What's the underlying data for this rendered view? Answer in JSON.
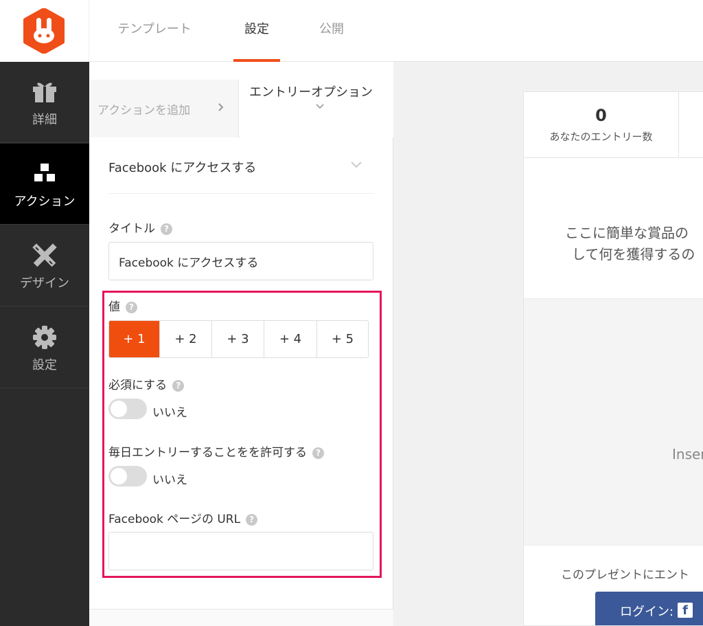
{
  "header": {
    "tabs": [
      {
        "label": "テンプレート"
      },
      {
        "label": "設定"
      },
      {
        "label": "公開"
      }
    ]
  },
  "sidebar": {
    "items": [
      {
        "label": "詳細",
        "icon": "gift-icon"
      },
      {
        "label": "アクション",
        "icon": "cubes-icon"
      },
      {
        "label": "デザイン",
        "icon": "pencil-ruler-icon"
      },
      {
        "label": "設定",
        "icon": "gear-icon"
      }
    ]
  },
  "panel": {
    "tab_add": "アクションを追加",
    "tab_entry": "エントリーオプション",
    "section_title": "Facebook にアクセスする",
    "title_label": "タイトル",
    "title_value": "Facebook にアクセスする",
    "value_label": "値",
    "value_options": [
      "+ 1",
      "+ 2",
      "+ 3",
      "+ 4",
      "+ 5"
    ],
    "value_selected": "+ 1",
    "required_label": "必須にする",
    "required_state": "いいえ",
    "daily_label": "毎日エントリーすることをを許可する",
    "daily_state": "いいえ",
    "fb_url_label": "Facebook ページの URL",
    "fb_url_value": ""
  },
  "preview": {
    "entries_count": "0",
    "entries_label": "あなたのエントリー数",
    "desc_line1": "ここに簡単な賞品の",
    "desc_line2": "して何を獲得するの",
    "insert_text": "Inser",
    "present_text": "このプレゼントにエント",
    "login_label": "ログイン:"
  },
  "colors": {
    "accent": "#f04e18",
    "highlight": "#e5155d",
    "sidebar_bg": "#2b2b2b",
    "facebook": "#3b5998"
  }
}
